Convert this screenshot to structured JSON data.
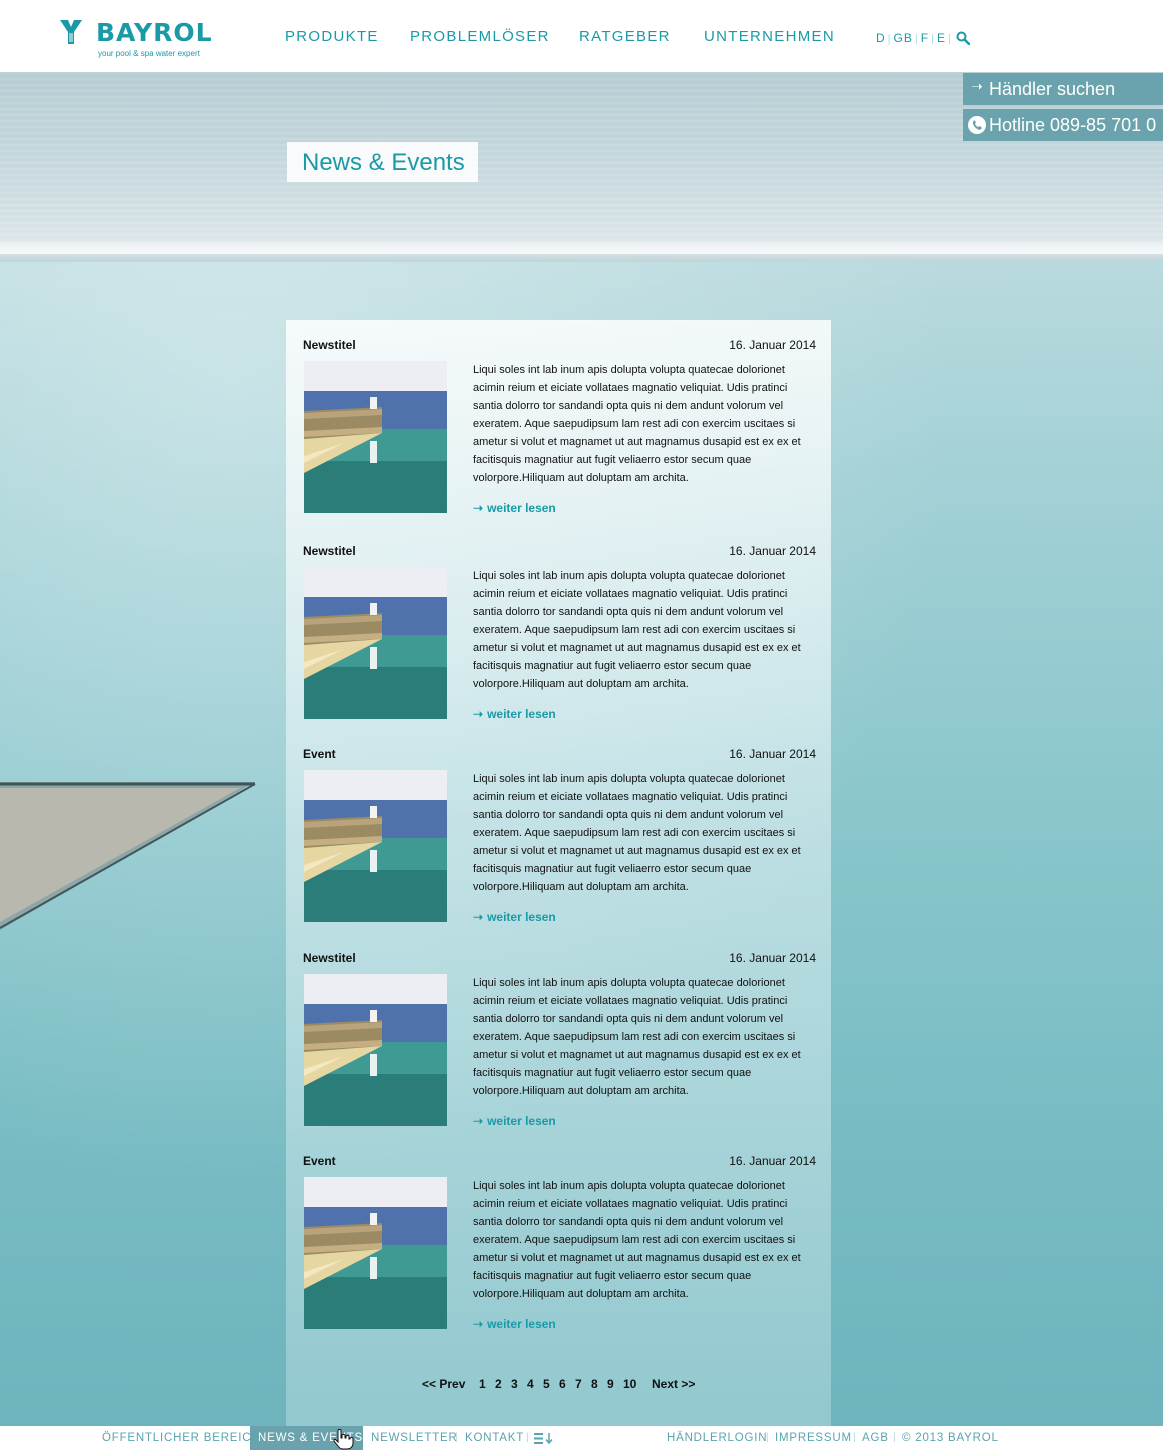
{
  "brand": {
    "name": "BAYROL",
    "tagline": "your pool & spa water expert",
    "color": "#1a9aa6"
  },
  "nav": {
    "items": [
      "PRODUKTE",
      "PROBLEMLÖSER",
      "RATGEBER",
      "UNTERNEHMEN"
    ]
  },
  "languages": [
    "D",
    "GB",
    "F",
    "E"
  ],
  "sidebar": {
    "dealer": "Händler suchen",
    "hotline": "Hotline 089-85 701 0"
  },
  "page": {
    "title": "News & Events"
  },
  "items": [
    {
      "title": "Newstitel",
      "date": "16. Januar 2014",
      "text": "Liqui soles int lab inum apis dolupta volupta quatecae dolorionet acimin reium et eiciate vollataes magnatio veliquiat. Udis pratinci santia dolorro tor sandandi opta quis ni dem andunt volorum vel exeratem. Aque saepudipsum lam rest adi con exercim uscitaes si ametur si volut et magnamet ut aut magnamus dusapid est ex ex et facitisquis magnatiur aut fugit veliaerro estor secum quae volorpore.Hiliquam aut doluptam am archita.",
      "more": "weiter lesen"
    },
    {
      "title": "Newstitel",
      "date": "16. Januar 2014",
      "text": "Liqui soles int lab inum apis dolupta volupta quatecae dolorionet acimin reium et eiciate vollataes magnatio veliquiat. Udis pratinci santia dolorro tor sandandi opta quis ni dem andunt volorum vel exeratem. Aque saepudipsum lam rest adi con exercim uscitaes si ametur si volut et magnamet ut aut magnamus dusapid est ex ex et facitisquis magnatiur aut fugit veliaerro estor secum quae volorpore.Hiliquam aut doluptam am archita.",
      "more": "weiter lesen"
    },
    {
      "title": "Event",
      "date": "16. Januar 2014",
      "text": "Liqui soles int lab inum apis dolupta volupta quatecae dolorionet acimin reium et eiciate vollataes magnatio veliquiat. Udis pratinci santia dolorro tor sandandi opta quis ni dem andunt volorum vel exeratem. Aque saepudipsum lam rest adi con exercim uscitaes si ametur si volut et magnamet ut aut magnamus dusapid est ex ex et facitisquis magnatiur aut fugit veliaerro estor secum quae volorpore.Hiliquam aut doluptam am archita.",
      "more": "weiter lesen"
    },
    {
      "title": "Newstitel",
      "date": "16. Januar 2014",
      "text": "Liqui soles int lab inum apis dolupta volupta quatecae dolorionet acimin reium et eiciate vollataes magnatio veliquiat. Udis pratinci santia dolorro tor sandandi opta quis ni dem andunt volorum vel exeratem. Aque saepudipsum lam rest adi con exercim uscitaes si ametur si volut et magnamet ut aut magnamus dusapid est ex ex et facitisquis magnatiur aut fugit veliaerro estor secum quae volorpore.Hiliquam aut doluptam am archita.",
      "more": "weiter lesen"
    },
    {
      "title": "Event",
      "date": "16. Januar 2014",
      "text": "Liqui soles int lab inum apis dolupta volupta quatecae dolorionet acimin reium et eiciate vollataes magnatio veliquiat. Udis pratinci santia dolorro tor sandandi opta quis ni dem andunt volorum vel exeratem. Aque saepudipsum lam rest adi con exercim uscitaes si ametur si volut et magnamet ut aut magnamus dusapid est ex ex et facitisquis magnatiur aut fugit veliaerro estor secum quae volorpore.Hiliquam aut doluptam am archita.",
      "more": "weiter lesen"
    }
  ],
  "pager": {
    "prev": "<< Prev",
    "pages": [
      "1",
      "2",
      "3",
      "4",
      "5",
      "6",
      "7",
      "8",
      "9",
      "10"
    ],
    "next": "Next >>"
  },
  "footer": {
    "left": [
      "ÖFFENTLICHER BEREICH",
      "NEWS & EVENTS",
      "NEWSLETTER",
      "KONTAKT"
    ],
    "active": "NEWS & EVENTS",
    "right": [
      "HÄNDLERLOGIN",
      "IMPRESSUM",
      "AGB",
      "© 2013 BAYROL"
    ]
  },
  "icons": {
    "search": "search-icon",
    "arrow": "arrow-right-icon",
    "phone": "phone-icon",
    "sitemap": "sitemap-icon"
  }
}
